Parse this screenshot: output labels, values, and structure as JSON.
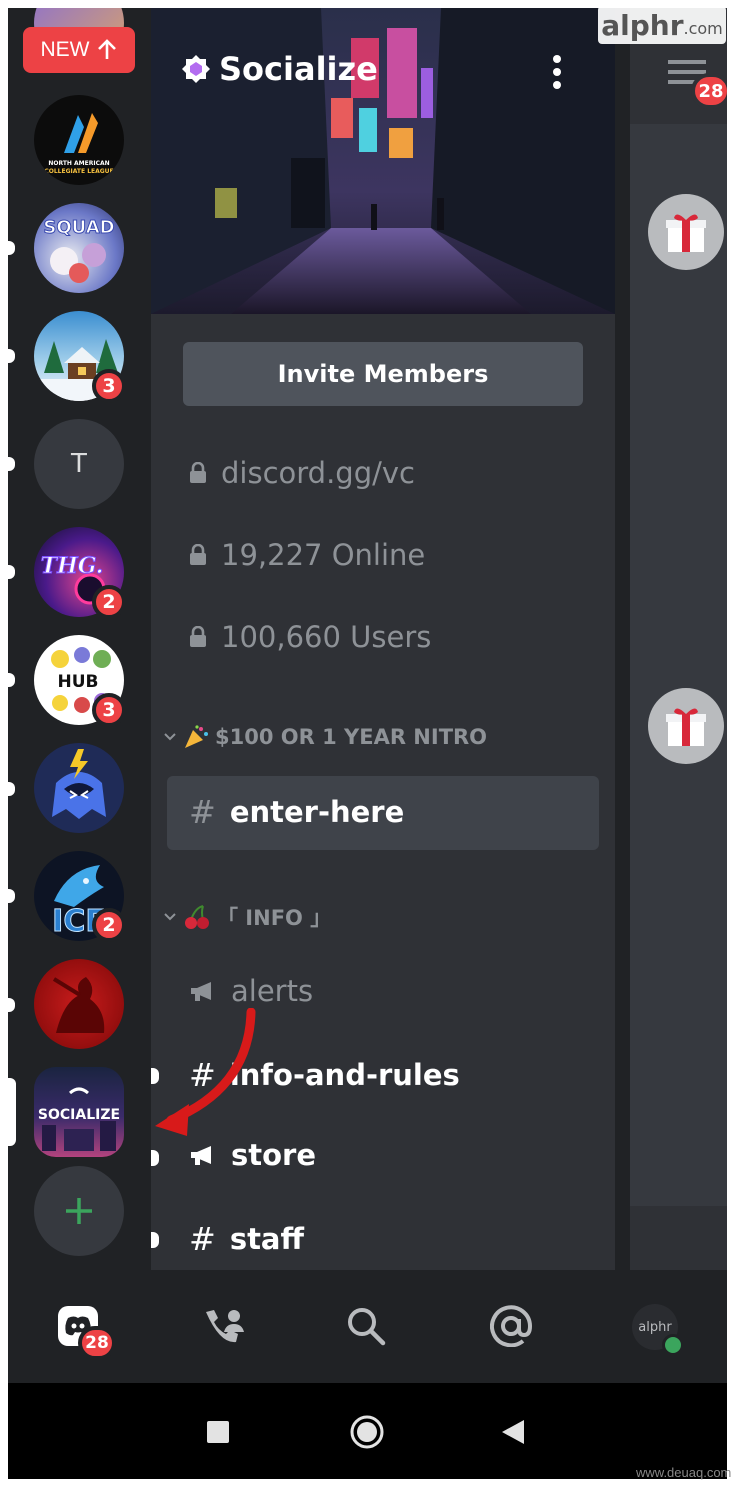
{
  "rail": {
    "new_label": "NEW",
    "servers": [
      {
        "name": "North American Collegiate League",
        "label": "NORTH AMERICAN COLLEGIATE LEAGUE",
        "badge": ""
      },
      {
        "name": "Squad",
        "label": "SQUAD",
        "badge": ""
      },
      {
        "name": "Winter cabin",
        "label": "",
        "badge": "3"
      },
      {
        "name": "T",
        "label": "T",
        "badge": ""
      },
      {
        "name": "THG",
        "label": "THG.",
        "badge": "2"
      },
      {
        "name": "The Hub",
        "label": "THE HUB",
        "badge": "3"
      },
      {
        "name": "Lightning mascot",
        "label": "",
        "badge": ""
      },
      {
        "name": "ICE",
        "label": "ICE",
        "badge": "2"
      },
      {
        "name": "Red server",
        "label": "",
        "badge": ""
      },
      {
        "name": "Socialize",
        "label": "SOCIALIZE",
        "badge": ""
      }
    ],
    "add_label": "+"
  },
  "panel": {
    "server_name": "Socialize",
    "invite_label": "Invite Members",
    "locked_rows": [
      "discord.gg/vc",
      "19,227 Online",
      "100,660 Users"
    ],
    "category1": "$100 OR 1 YEAR NITRO",
    "selected_channel": "enter-here",
    "category2": "「 INFO 」",
    "channels": [
      {
        "name": "alerts",
        "type": "announcement",
        "unread": false
      },
      {
        "name": "info-and-rules",
        "type": "text",
        "unread": true
      },
      {
        "name": "store",
        "type": "announcement",
        "unread": true
      },
      {
        "name": "staff",
        "type": "text",
        "unread": true
      }
    ]
  },
  "right": {
    "menu_badge": "28"
  },
  "nav": {
    "home_badge": "28",
    "avatar_label": "alphr"
  },
  "watermark": {
    "brand": "alphr",
    "suffix": ".com"
  },
  "footer": "www.deuaq.com",
  "colors": {
    "background": "#202225",
    "panel": "#2f3136",
    "selected": "#3f434a",
    "badge": "#ed4245",
    "add": "#3ba55d"
  }
}
